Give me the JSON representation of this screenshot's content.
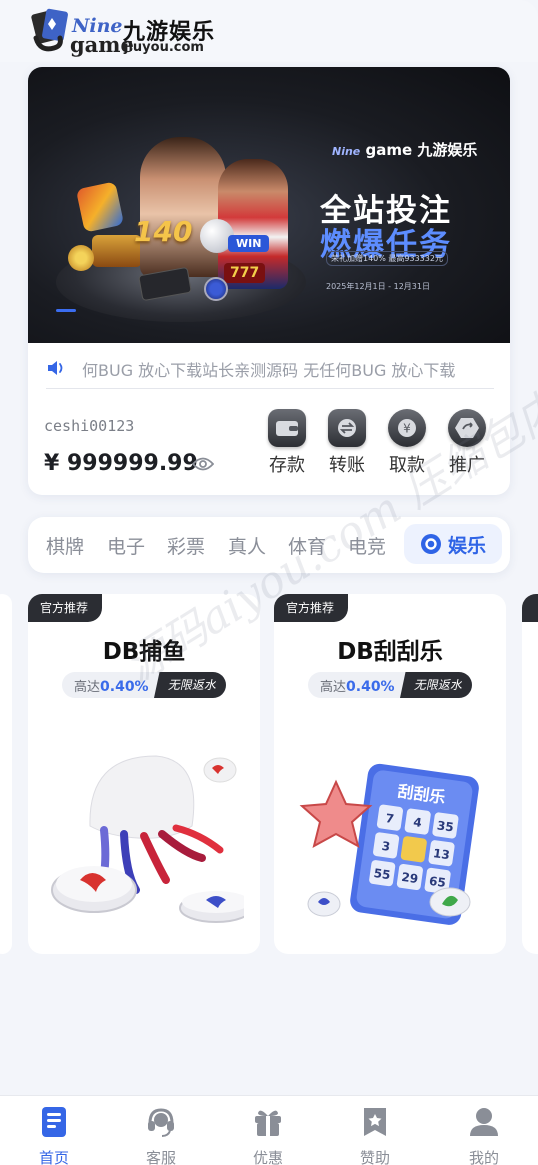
{
  "logo": {
    "nine": "Nine",
    "game": "game",
    "cn": "九游娱乐",
    "domain": "jiuyou.com"
  },
  "banner": {
    "brand": "九游娱乐",
    "brand_nine": "Nine",
    "brand_game": "game",
    "headline_1": "全站投注",
    "headline_2": "燃爆任务",
    "number": "140",
    "sub": "荣礼加赠140% 最高933332元",
    "date": "2025年12月1日 - 12月31日",
    "win": "WIN",
    "sevens": "777"
  },
  "notice": {
    "text": "何BUG 放心下载站长亲测源码 无任何BUG 放心下载"
  },
  "account": {
    "username": "ceshi00123",
    "balance": "¥ 999999.99"
  },
  "actions": [
    {
      "label": "存款",
      "icon": "wallet-icon"
    },
    {
      "label": "转账",
      "icon": "transfer-icon"
    },
    {
      "label": "取款",
      "icon": "withdraw-icon"
    },
    {
      "label": "推广",
      "icon": "share-icon"
    }
  ],
  "tabs": [
    {
      "label": "棋牌"
    },
    {
      "label": "电子"
    },
    {
      "label": "彩票"
    },
    {
      "label": "真人"
    },
    {
      "label": "体育"
    },
    {
      "label": "电竞"
    },
    {
      "label": "娱乐",
      "active": true
    }
  ],
  "games": [
    {
      "badge": "官方推荐",
      "title": "DB捕鱼",
      "rebate_prefix": "高达",
      "rebate_value": "0.40%",
      "rebate_tag": "无限返水"
    },
    {
      "badge": "官方推荐",
      "title": "DB刮刮乐",
      "rebate_prefix": "高达",
      "rebate_value": "0.40%",
      "rebate_tag": "无限返水"
    }
  ],
  "scratch": {
    "title": "刮刮乐",
    "numbers": [
      "7",
      "4",
      "35",
      "3",
      "",
      "13",
      "55",
      "29",
      "65"
    ]
  },
  "watermark": "源码aiyou.com 压缩包内附有资源图片",
  "nav": [
    {
      "label": "首页",
      "icon": "home-icon",
      "active": true
    },
    {
      "label": "客服",
      "icon": "headset-icon"
    },
    {
      "label": "优惠",
      "icon": "gift-icon"
    },
    {
      "label": "赞助",
      "icon": "sponsor-icon"
    },
    {
      "label": "我的",
      "icon": "user-icon"
    }
  ],
  "colors": {
    "accent": "#3566e6",
    "dark": "#2b2d33",
    "background": "#f3f5fa"
  }
}
